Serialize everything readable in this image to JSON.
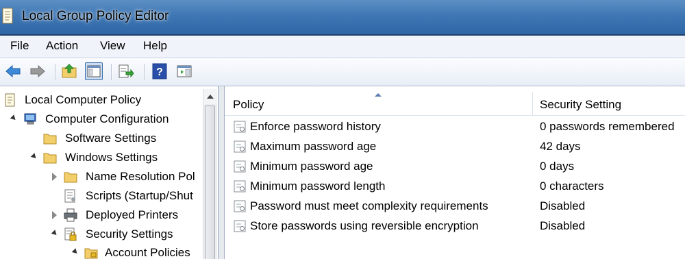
{
  "window": {
    "title": "Local Group Policy Editor"
  },
  "menu": [
    "File",
    "Action",
    "View",
    "Help"
  ],
  "toolbar": {
    "buttons": [
      "back-icon",
      "forward-icon",
      "up-folder-icon",
      "show-hide-tree-icon",
      "export-list-icon",
      "help-icon",
      "show-hide-action-pane-icon"
    ]
  },
  "tree": {
    "items": [
      {
        "label": "Local Computer Policy",
        "icon": "policy-scroll-icon",
        "expander": "none"
      },
      {
        "label": "Computer Configuration",
        "icon": "computer-icon",
        "expander": "open"
      },
      {
        "label": "Software Settings",
        "icon": "folder-icon",
        "expander": "none"
      },
      {
        "label": "Windows Settings",
        "icon": "folder-icon",
        "expander": "open"
      },
      {
        "label": "Name Resolution Pol",
        "icon": "folder-icon",
        "expander": "closed"
      },
      {
        "label": "Scripts (Startup/Shut",
        "icon": "scripts-icon",
        "expander": "none"
      },
      {
        "label": "Deployed Printers",
        "icon": "printer-icon",
        "expander": "closed"
      },
      {
        "label": "Security Settings",
        "icon": "security-icon",
        "expander": "open"
      },
      {
        "label": "Account Policies",
        "icon": "locked-folder-icon",
        "expander": "open"
      }
    ]
  },
  "list": {
    "columns": [
      "Policy",
      "Security Setting"
    ],
    "rows": [
      {
        "policy": "Enforce password history",
        "setting": "0 passwords remembered"
      },
      {
        "policy": "Maximum password age",
        "setting": "42 days"
      },
      {
        "policy": "Minimum password age",
        "setting": "0 days"
      },
      {
        "policy": "Minimum password length",
        "setting": "0 characters"
      },
      {
        "policy": "Password must meet complexity requirements",
        "setting": "Disabled"
      },
      {
        "policy": "Store passwords using reversible encryption",
        "setting": "Disabled"
      }
    ]
  },
  "colors": {
    "titlebar": "#3f77b4",
    "folder": "#f3cf6b",
    "toolbar_bg": "#e8eef7"
  }
}
